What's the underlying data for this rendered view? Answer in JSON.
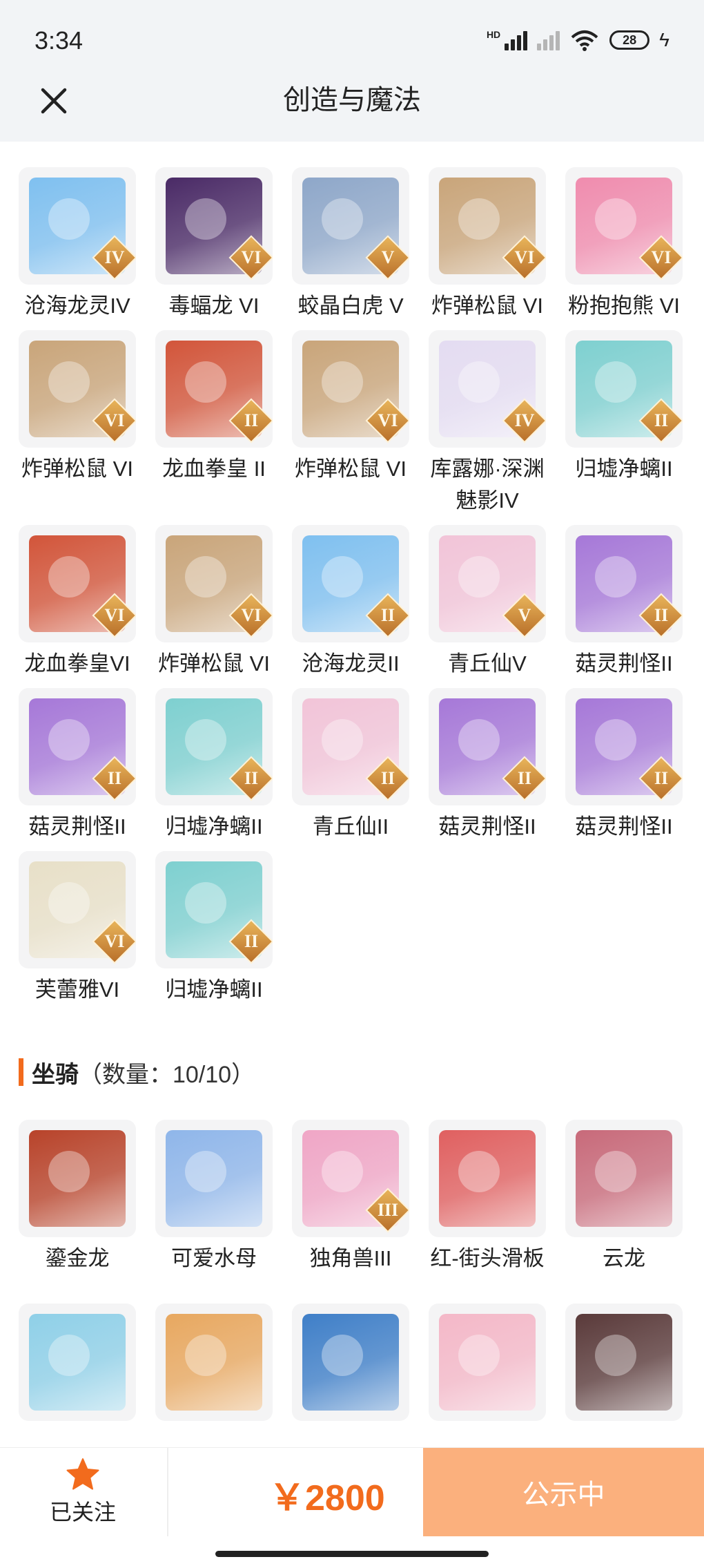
{
  "status": {
    "time": "3:34",
    "network_label": "HD",
    "battery": "28"
  },
  "nav": {
    "title": "创造与魔法"
  },
  "pets": [
    {
      "name": "沧海龙灵IV",
      "tier": "IV",
      "color": "#7fc0f0"
    },
    {
      "name": "毒蝠龙 VI",
      "tier": "VI",
      "color": "#4a2a66"
    },
    {
      "name": "蛟晶白虎 V",
      "tier": "V",
      "color": "#8ea7c9"
    },
    {
      "name": "炸弹松鼠 VI",
      "tier": "VI",
      "color": "#c9a57a"
    },
    {
      "name": "粉抱抱熊 VI",
      "tier": "VI",
      "color": "#f08cae"
    },
    {
      "name": "炸弹松鼠 VI",
      "tier": "VI",
      "color": "#c9a57a"
    },
    {
      "name": "龙血拳皇 II",
      "tier": "II",
      "color": "#d2553a"
    },
    {
      "name": "炸弹松鼠 VI",
      "tier": "VI",
      "color": "#c9a57a"
    },
    {
      "name": "库露娜·深渊魅影IV",
      "tier": "IV",
      "color": "#e4dcf2"
    },
    {
      "name": "归墟净螭II",
      "tier": "II",
      "color": "#7ed0d0"
    },
    {
      "name": "龙血拳皇VI",
      "tier": "VI",
      "color": "#d2553a"
    },
    {
      "name": "炸弹松鼠 VI",
      "tier": "VI",
      "color": "#c9a57a"
    },
    {
      "name": "沧海龙灵II",
      "tier": "II",
      "color": "#7fc0f0"
    },
    {
      "name": "青丘仙V",
      "tier": "V",
      "color": "#f2c4d8"
    },
    {
      "name": "菇灵荆怪II",
      "tier": "II",
      "color": "#a678d8"
    },
    {
      "name": "菇灵荆怪II",
      "tier": "II",
      "color": "#a678d8"
    },
    {
      "name": "归墟净螭II",
      "tier": "II",
      "color": "#7ed0d0"
    },
    {
      "name": "青丘仙II",
      "tier": "II",
      "color": "#f2c4d8"
    },
    {
      "name": "菇灵荆怪II",
      "tier": "II",
      "color": "#a678d8"
    },
    {
      "name": "菇灵荆怪II",
      "tier": "II",
      "color": "#a678d8"
    },
    {
      "name": "芙蕾雅VI",
      "tier": "VI",
      "color": "#e8e0c8"
    },
    {
      "name": "归墟净螭II",
      "tier": "II",
      "color": "#7ed0d0"
    }
  ],
  "mounts_section": {
    "title": "坐骑",
    "count": "（数量：10/10）"
  },
  "mounts": [
    {
      "name": "鎏金龙",
      "tier": "",
      "color": "#b8432a"
    },
    {
      "name": "可爱水母",
      "tier": "",
      "color": "#8fb6ea"
    },
    {
      "name": "独角兽III",
      "tier": "III",
      "color": "#f0a6c6"
    },
    {
      "name": "红-街头滑板",
      "tier": "",
      "color": "#e06060"
    },
    {
      "name": "云龙",
      "tier": "",
      "color": "#c86a7a"
    },
    {
      "name": "",
      "tier": "",
      "color": "#8fd0e8"
    },
    {
      "name": "",
      "tier": "",
      "color": "#e8a860"
    },
    {
      "name": "",
      "tier": "",
      "color": "#3f7fc8"
    },
    {
      "name": "",
      "tier": "",
      "color": "#f4b8c8"
    },
    {
      "name": "",
      "tier": "",
      "color": "#5a3a3a"
    }
  ],
  "bottom": {
    "follow_label": "已关注",
    "price": "￥2800",
    "cta_label": "公示中"
  },
  "colors": {
    "accent": "#f26b1d",
    "cta_bg": "#fbb07d",
    "header_bg": "#f2f4f6"
  }
}
